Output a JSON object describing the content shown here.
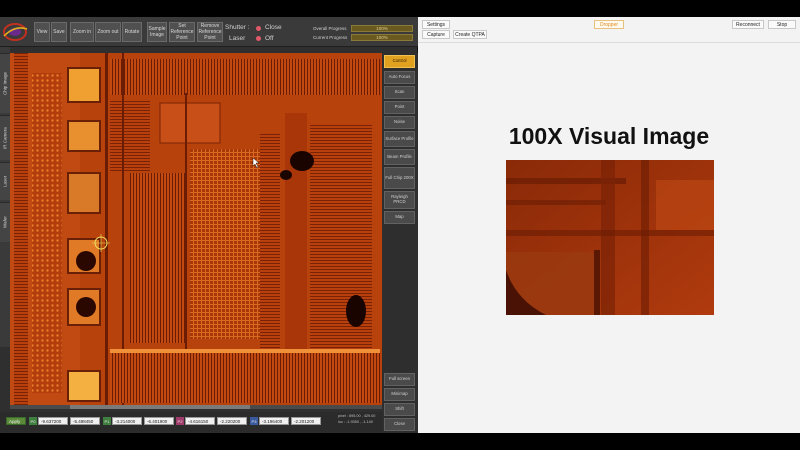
{
  "toolbar": {
    "buttons": {
      "view": "View",
      "save": "Save",
      "zoom_in": "Zoom in",
      "zoom_out": "Zoom out",
      "rotate": "Rotate",
      "sample_image": "Sample Image",
      "set_reference_point": "Set Reference Point",
      "remove_reference_point": "Remove Reference Point"
    },
    "shutter_label": "Shutter :",
    "shutter_value": "Close",
    "laser_label": "Laser",
    "laser_value": "Off",
    "overall_progress_label": "Overall Progress",
    "overall_progress_value": 100,
    "overall_progress_text": "100%",
    "current_progress_label": "Current Progress",
    "current_progress_value": 100,
    "current_progress_text": "100%",
    "status_color": "#e05a6a"
  },
  "side_tabs": [
    "Chip Image",
    "IR Camera",
    "Laser",
    "Wafer"
  ],
  "right_menu": {
    "items": [
      "Control",
      "Auto Focus",
      "Scan",
      "Point",
      "Noise",
      "Surface Profile",
      "Beam Profile",
      "Full Chip 200X",
      "Rayleigh PRCD",
      "Map"
    ],
    "bottom_items": [
      "Full screen",
      "Minimap",
      "Shift",
      "Close"
    ],
    "active_color": "#e0a020"
  },
  "bottom": {
    "apply_label": "Apply",
    "points": [
      {
        "tag": "P0",
        "x": "-9.637200",
        "y": "-5.498450"
      },
      {
        "tag": "P1",
        "x": "-3.214000",
        "y": "-6.401900"
      },
      {
        "tag": "P2",
        "x": "-4.616150",
        "y": "-2.220200"
      },
      {
        "tag": "P3",
        "x": "-3.196400",
        "y": "-2.201200"
      }
    ],
    "info_line1": "pixel : 895.00 , 429.00",
    "info_line2": "loc : -1.9350 , -1.140"
  },
  "right_panel": {
    "settings_label": "Settings",
    "capture_label": "Capture",
    "create_qtpa_label": "Create QTPA",
    "dropper_label": "Dropper",
    "reconnect_label": "Reconnect",
    "stop_label": "Stop",
    "title": "100X Visual Image"
  }
}
